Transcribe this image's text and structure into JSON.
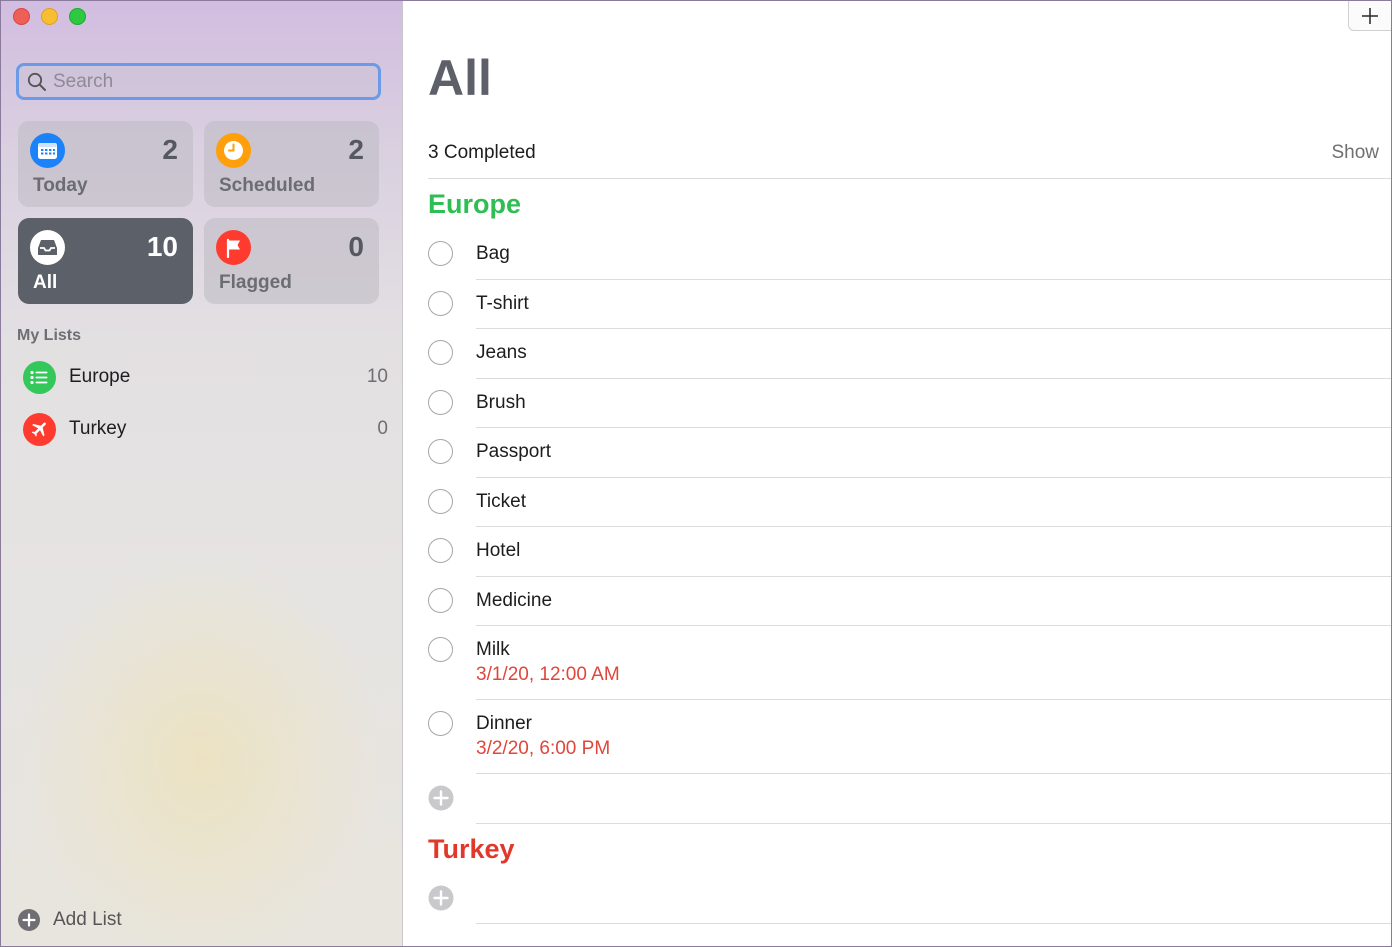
{
  "search": {
    "placeholder": "Search"
  },
  "smart_lists": [
    {
      "label": "Today",
      "count": "2",
      "icon": "calendar-icon",
      "color": "#1a82fb"
    },
    {
      "label": "Scheduled",
      "count": "2",
      "icon": "clock-icon",
      "color": "#ff9f0a"
    },
    {
      "label": "All",
      "count": "10",
      "icon": "tray-icon",
      "color": "#5c6068",
      "selected": true
    },
    {
      "label": "Flagged",
      "count": "0",
      "icon": "flag-icon",
      "color": "#ff3b30"
    }
  ],
  "my_lists": {
    "header": "My Lists",
    "items": [
      {
        "name": "Europe",
        "count": "10",
        "icon": "list-bullet-icon",
        "color": "#34c759"
      },
      {
        "name": "Turkey",
        "count": "0",
        "icon": "airplane-icon",
        "color": "#ff3b30"
      }
    ]
  },
  "add_list_label": "Add List",
  "main": {
    "title": "All",
    "completed_text": "3 Completed",
    "show_label": "Show",
    "sections": [
      {
        "name": "Europe",
        "color": "#2fbe54",
        "items": [
          {
            "title": "Bag"
          },
          {
            "title": "T-shirt"
          },
          {
            "title": "Jeans"
          },
          {
            "title": "Brush"
          },
          {
            "title": "Passport"
          },
          {
            "title": "Ticket"
          },
          {
            "title": "Hotel"
          },
          {
            "title": "Medicine"
          },
          {
            "title": "Milk",
            "date": "3/1/20, 12:00 AM"
          },
          {
            "title": "Dinner",
            "date": "3/2/20, 6:00 PM"
          }
        ]
      },
      {
        "name": "Turkey",
        "color": "#e0392c",
        "items": []
      }
    ]
  },
  "colors": {
    "accent_blue": "#1a82fb",
    "date_red": "#e0463a"
  }
}
